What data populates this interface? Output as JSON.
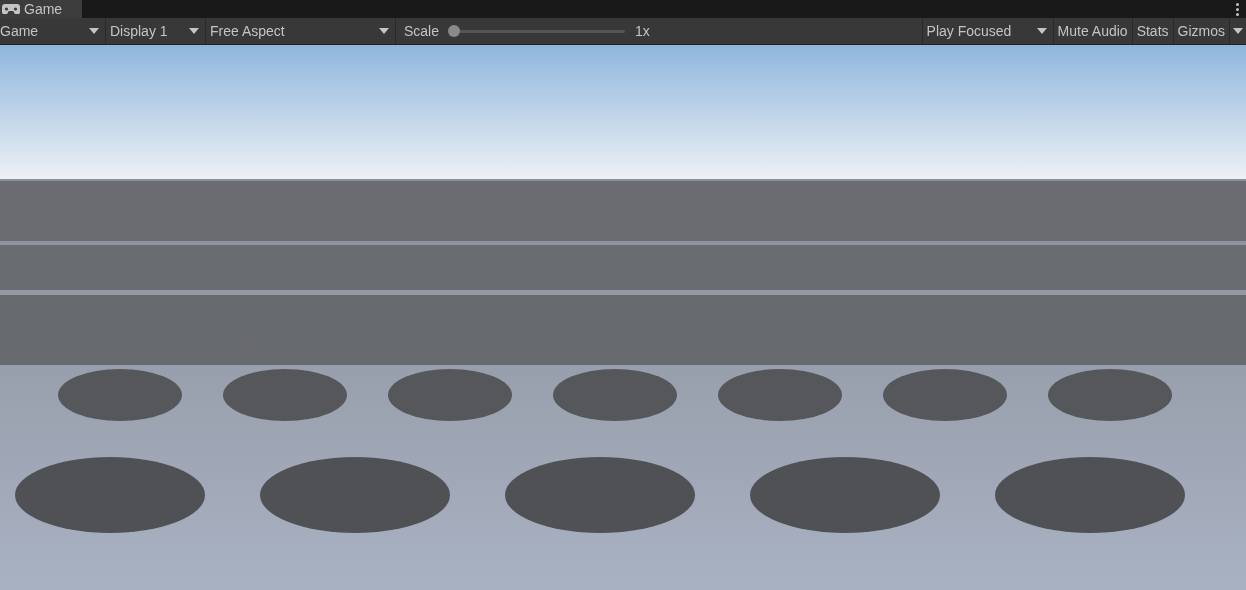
{
  "tabs": [
    {
      "label": "Game",
      "selected": true
    }
  ],
  "toolbar": {
    "view_dropdown": "Game",
    "display_dropdown": "Display 1",
    "aspect_dropdown": "Free Aspect",
    "scale": {
      "label": "Scale",
      "level": 0,
      "reading": "1x"
    },
    "play_mode_dropdown": "Play Focused",
    "toggles": [
      {
        "label": "Mute Audio",
        "on": false
      },
      {
        "label": "Stats",
        "on": false
      },
      {
        "label": "Gizmos",
        "on": false
      }
    ]
  }
}
